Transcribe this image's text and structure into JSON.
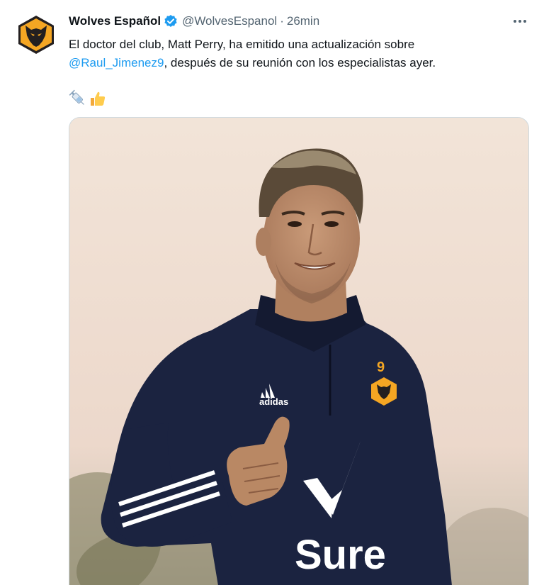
{
  "tweet": {
    "display_name": "Wolves Español",
    "handle": "@WolvesEspanol",
    "separator": "·",
    "time": "26min",
    "text_before_mention": "El doctor del club, Matt Perry, ha emitido una actualización sobre ",
    "mention": "@Raul_Jimenez9",
    "text_after_mention": ", después de su reunión con los especialistas ayer.",
    "emojis": [
      "syringe-emoji",
      "thumbs-up-emoji"
    ]
  },
  "media": {
    "shirt_number": "9",
    "kit_brand": "adidas",
    "sponsor": "Sure"
  },
  "colors": {
    "link": "#1d9bf0",
    "verified": "#1d9bf0",
    "secondary_text": "#536471",
    "wolves_gold": "#f5a623",
    "jersey_navy": "#1b2340"
  }
}
